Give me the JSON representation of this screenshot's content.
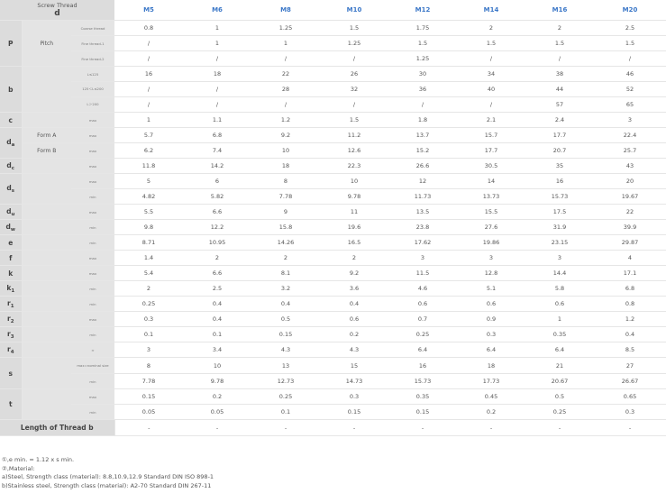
{
  "header": {
    "corner_title": "Screw Thread",
    "corner_sub": "d",
    "sizes": [
      "M5",
      "M6",
      "M8",
      "M10",
      "M12",
      "M14",
      "M16",
      "M20"
    ]
  },
  "rows": [
    {
      "param": "P",
      "label": "Pitch",
      "cond": "Coarse thread",
      "values": [
        "0.8",
        "1",
        "1.25",
        "1.5",
        "1.75",
        "2",
        "2",
        "2.5"
      ]
    },
    {
      "param": "",
      "label": "",
      "cond": "Fine thread-1",
      "values": [
        "/",
        "1",
        "1",
        "1.25",
        "1.5",
        "1.5",
        "1.5",
        "1.5"
      ]
    },
    {
      "param": "",
      "label": "",
      "cond": "Fine thread-2",
      "values": [
        "/",
        "/",
        "/",
        "/",
        "1.25",
        "/",
        "/",
        "/"
      ]
    },
    {
      "param": "b",
      "label": "",
      "cond": "L≤125",
      "values": [
        "16",
        "18",
        "22",
        "26",
        "30",
        "34",
        "38",
        "46"
      ]
    },
    {
      "param": "",
      "label": "",
      "cond": "125＜L≤200",
      "values": [
        "/",
        "/",
        "28",
        "32",
        "36",
        "40",
        "44",
        "52"
      ]
    },
    {
      "param": "",
      "label": "",
      "cond": "L＞200",
      "values": [
        "/",
        "/",
        "/",
        "/",
        "/",
        "/",
        "57",
        "65"
      ]
    },
    {
      "param": "c",
      "label": "",
      "cond": "max",
      "values": [
        "1",
        "1.1",
        "1.2",
        "1.5",
        "1.8",
        "2.1",
        "2.4",
        "3"
      ]
    },
    {
      "param": "da",
      "label": "Form A",
      "cond": "max",
      "values": [
        "5.7",
        "6.8",
        "9.2",
        "11.2",
        "13.7",
        "15.7",
        "17.7",
        "22.4"
      ]
    },
    {
      "param": "",
      "label": "Form B",
      "cond": "max",
      "values": [
        "6.2",
        "7.4",
        "10",
        "12.6",
        "15.2",
        "17.7",
        "20.7",
        "25.7"
      ]
    },
    {
      "param": "dc",
      "label": "",
      "cond": "max",
      "values": [
        "11.8",
        "14.2",
        "18",
        "22.3",
        "26.6",
        "30.5",
        "35",
        "43"
      ]
    },
    {
      "param": "ds",
      "label": "",
      "cond": "max",
      "values": [
        "5",
        "6",
        "8",
        "10",
        "12",
        "14",
        "16",
        "20"
      ]
    },
    {
      "param": "",
      "label": "",
      "cond": "min",
      "values": [
        "4.82",
        "5.82",
        "7.78",
        "9.78",
        "11.73",
        "13.73",
        "15.73",
        "19.67"
      ]
    },
    {
      "param": "du",
      "label": "",
      "cond": "max",
      "values": [
        "5.5",
        "6.6",
        "9",
        "11",
        "13.5",
        "15.5",
        "17.5",
        "22"
      ]
    },
    {
      "param": "dw",
      "label": "",
      "cond": "min",
      "values": [
        "9.8",
        "12.2",
        "15.8",
        "19.6",
        "23.8",
        "27.6",
        "31.9",
        "39.9"
      ]
    },
    {
      "param": "e",
      "label": "",
      "cond": "min",
      "values": [
        "8.71",
        "10.95",
        "14.26",
        "16.5",
        "17.62",
        "19.86",
        "23.15",
        "29.87"
      ]
    },
    {
      "param": "f",
      "label": "",
      "cond": "max",
      "values": [
        "1.4",
        "2",
        "2",
        "2",
        "3",
        "3",
        "3",
        "4"
      ]
    },
    {
      "param": "k",
      "label": "",
      "cond": "max",
      "values": [
        "5.4",
        "6.6",
        "8.1",
        "9.2",
        "11.5",
        "12.8",
        "14.4",
        "17.1"
      ]
    },
    {
      "param": "k1",
      "label": "",
      "cond": "min",
      "values": [
        "2",
        "2.5",
        "3.2",
        "3.6",
        "4.6",
        "5.1",
        "5.8",
        "6.8"
      ]
    },
    {
      "param": "r1",
      "label": "",
      "cond": "min",
      "values": [
        "0.25",
        "0.4",
        "0.4",
        "0.4",
        "0.6",
        "0.6",
        "0.6",
        "0.8"
      ]
    },
    {
      "param": "r2",
      "label": "",
      "cond": "max",
      "values": [
        "0.3",
        "0.4",
        "0.5",
        "0.6",
        "0.7",
        "0.9",
        "1",
        "1.2"
      ]
    },
    {
      "param": "r3",
      "label": "",
      "cond": "min",
      "values": [
        "0.1",
        "0.1",
        "0.15",
        "0.2",
        "0.25",
        "0.3",
        "0.35",
        "0.4"
      ]
    },
    {
      "param": "r4",
      "label": "",
      "cond": "≈",
      "values": [
        "3",
        "3.4",
        "4.3",
        "4.3",
        "6.4",
        "6.4",
        "6.4",
        "8.5"
      ]
    },
    {
      "param": "s",
      "label": "",
      "cond": "max=nominal size",
      "values": [
        "8",
        "10",
        "13",
        "15",
        "16",
        "18",
        "21",
        "27"
      ]
    },
    {
      "param": "",
      "label": "",
      "cond": "min",
      "values": [
        "7.78",
        "9.78",
        "12.73",
        "14.73",
        "15.73",
        "17.73",
        "20.67",
        "26.67"
      ]
    },
    {
      "param": "t",
      "label": "",
      "cond": "max",
      "values": [
        "0.15",
        "0.2",
        "0.25",
        "0.3",
        "0.35",
        "0.45",
        "0.5",
        "0.65"
      ]
    },
    {
      "param": "",
      "label": "",
      "cond": "min",
      "values": [
        "0.05",
        "0.05",
        "0.1",
        "0.15",
        "0.15",
        "0.2",
        "0.25",
        "0.3"
      ]
    }
  ],
  "length_row": {
    "label": "Length of Thread b",
    "values": [
      "-",
      "-",
      "-",
      "-",
      "-",
      "-",
      "-",
      "-"
    ]
  },
  "notes": [
    "①,e min. = 1.12 x s min.",
    "②,Material:",
    "a)Steel, Strength class (material): 8.8,10.9,12.9 Standard DIN ISO 898-1",
    "b)Stainless steel, Strength class (material): A2-70 Standard DIN 267-11"
  ]
}
